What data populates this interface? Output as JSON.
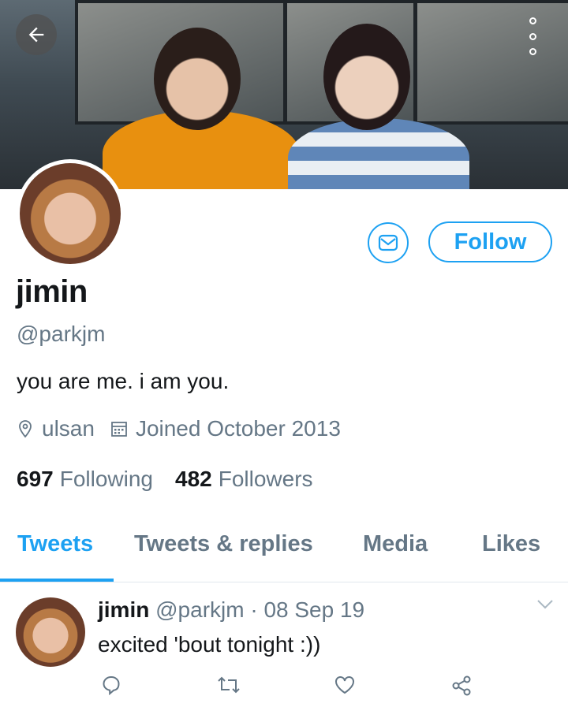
{
  "header": {
    "back_icon": "arrow-left-icon",
    "more_icon": "vertical-ellipsis-icon",
    "banner": "banner-photo-two-people"
  },
  "profile": {
    "name": "jimin",
    "handle": "@parkjm",
    "bio": "you are me. i am you.",
    "location": "ulsan",
    "joined": "Joined October 2013",
    "following_count": "697",
    "following_label": "Following",
    "followers_count": "482",
    "followers_label": "Followers",
    "follow_label": "Follow",
    "message_icon": "envelope-icon"
  },
  "tabs": [
    {
      "label": "Tweets",
      "active": true
    },
    {
      "label": "Tweets & replies",
      "active": false
    },
    {
      "label": "Media",
      "active": false
    },
    {
      "label": "Likes",
      "active": false
    }
  ],
  "tweet": {
    "name": "jimin",
    "handle": "@parkjm",
    "separator": "·",
    "date": "08 Sep 19",
    "text": "excited 'bout tonight :))",
    "actions": [
      "reply-icon",
      "retweet-icon",
      "like-icon",
      "share-icon"
    ]
  },
  "colors": {
    "accent": "#1da1f2",
    "secondary_text": "#657786",
    "primary_text": "#14171a"
  }
}
